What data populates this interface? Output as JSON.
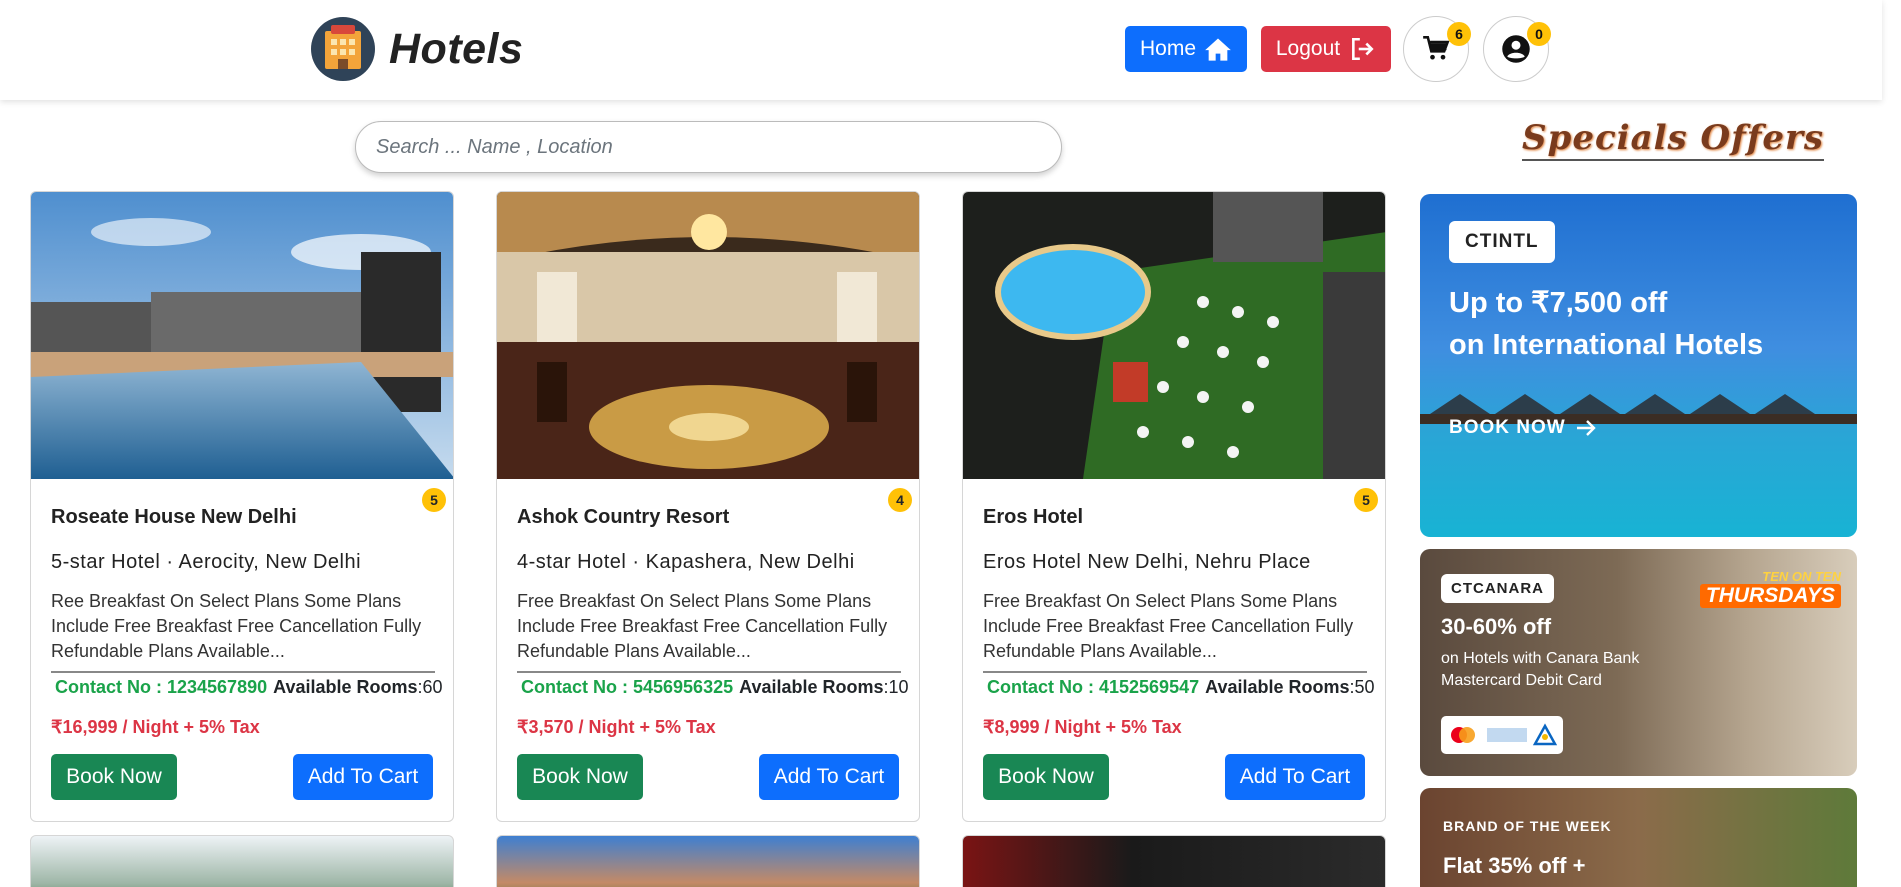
{
  "navbar": {
    "brand": "Hotels",
    "logo_icon": "hotel-building-icon",
    "home_label": "Home",
    "logout_label": "Logout",
    "cart_count": "6",
    "user_count": "0"
  },
  "search": {
    "placeholder": "Search ... Name , Location"
  },
  "specials": {
    "heading": "Specials Offers"
  },
  "hotels": [
    {
      "name": "Roseate House New Delhi",
      "rating": "5",
      "subtitle": "5-star Hotel · Aerocity, New Delhi",
      "description": "Ree Breakfast On Select Plans Some Plans Include Free Breakfast Free Cancellation Fully Refundable Plans Available...",
      "contact": "Contact No : 1234567890",
      "rooms_label": "Available Rooms",
      "rooms": ":60",
      "price": "₹16,999 / Night + 5% Tax",
      "book_label": "Book Now",
      "cart_label": "Add To Cart"
    },
    {
      "name": "Ashok Country Resort",
      "rating": "4",
      "subtitle": "4-star Hotel · Kapashera, New Delhi",
      "description": "Free Breakfast On Select Plans Some Plans Include Free Breakfast Free Cancellation Fully Refundable Plans Available...",
      "contact": "Contact No : 5456956325",
      "rooms_label": "Available Rooms",
      "rooms": ":10",
      "price": "₹3,570 / Night + 5% Tax",
      "book_label": "Book Now",
      "cart_label": "Add To Cart"
    },
    {
      "name": "Eros Hotel",
      "rating": "5",
      "subtitle": "Eros Hotel New Delhi, Nehru Place",
      "description": "Free Breakfast On Select Plans Some Plans Include Free Breakfast Free Cancellation Fully Refundable Plans Available...",
      "contact": "Contact No : 4152569547",
      "rooms_label": "Available Rooms",
      "rooms": ":50",
      "price": "₹8,999 / Night + 5% Tax",
      "book_label": "Book Now",
      "cart_label": "Add To Cart"
    }
  ],
  "offers": [
    {
      "code": "CTINTL",
      "line1": "Up to ₹7,500 off",
      "line2": "on International Hotels",
      "cta": "BOOK NOW"
    },
    {
      "code": "CTCANARA",
      "badge_top": "TEN ON TEN",
      "badge_main": "THURSDAYS",
      "headline": "30-60% off",
      "line1": "on Hotels with Canara Bank",
      "line2": "Mastercard Debit Card"
    },
    {
      "eyebrow": "BRAND OF THE WEEK",
      "headline": "Flat 35% off +"
    }
  ]
}
